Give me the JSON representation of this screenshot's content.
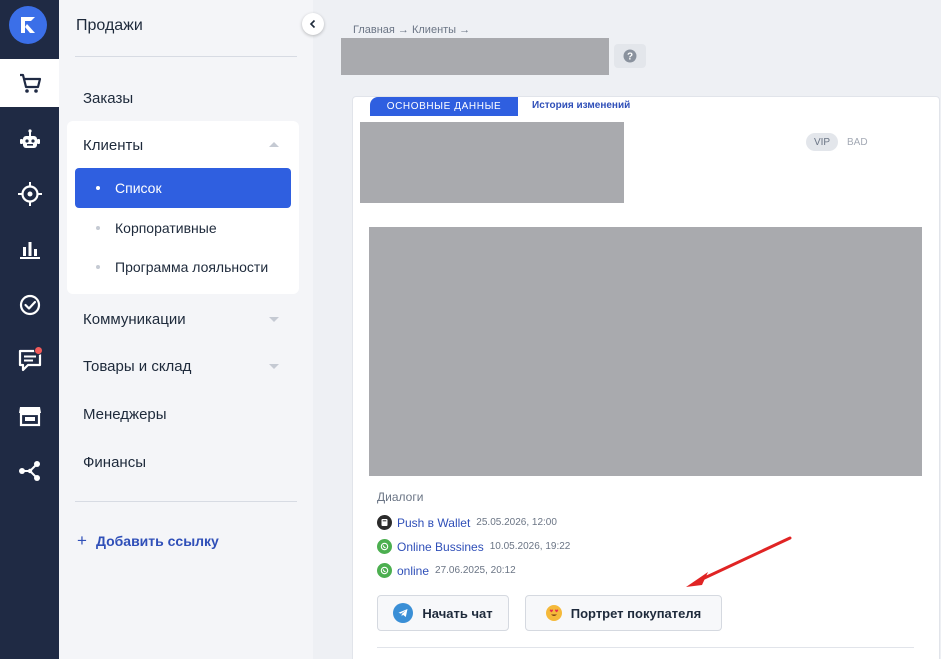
{
  "nav": {
    "title": "Продажи",
    "items": [
      {
        "label": "Заказы"
      },
      {
        "label": "Клиенты"
      },
      {
        "label": "Коммуникации"
      },
      {
        "label": "Товары и склад"
      },
      {
        "label": "Менеджеры"
      },
      {
        "label": "Финансы"
      }
    ],
    "clients_sub": [
      {
        "label": "Список",
        "active": true
      },
      {
        "label": "Корпоративные"
      },
      {
        "label": "Программа лояльности"
      }
    ],
    "add_link": "Добавить ссылку"
  },
  "rail": {
    "icons": [
      "logo-icon",
      "cart-icon",
      "bot-icon",
      "target-icon",
      "analytics-icon",
      "tasks-icon",
      "chat-icon",
      "store-icon",
      "integrations-icon"
    ],
    "active": "cart-icon"
  },
  "breadcrumb": "Главная → Клиенты →",
  "tabs": {
    "main": "ОСНОВНЫЕ ДАННЫЕ",
    "history": "История изменений"
  },
  "tags": {
    "vip": "VIP",
    "bad": "BAD"
  },
  "dialogs": {
    "title": "Диалоги",
    "items": [
      {
        "name": "Push в Wallet",
        "time": "25.05.2026, 12:00",
        "channel": "push-icon"
      },
      {
        "name": "Online Bussines",
        "time": "10.05.2026, 19:22",
        "channel": "whatsapp-icon"
      },
      {
        "name": "online",
        "time": "27.06.2025, 20:12",
        "channel": "whatsapp-icon"
      }
    ]
  },
  "buttons": {
    "start_chat": "Начать чат",
    "customer_portrait": "Портрет покупателя"
  },
  "colors": {
    "accent": "#2f5fe0",
    "rail": "#1f2a44",
    "whatsapp": "#4caf50",
    "arrow": "#e02424"
  }
}
